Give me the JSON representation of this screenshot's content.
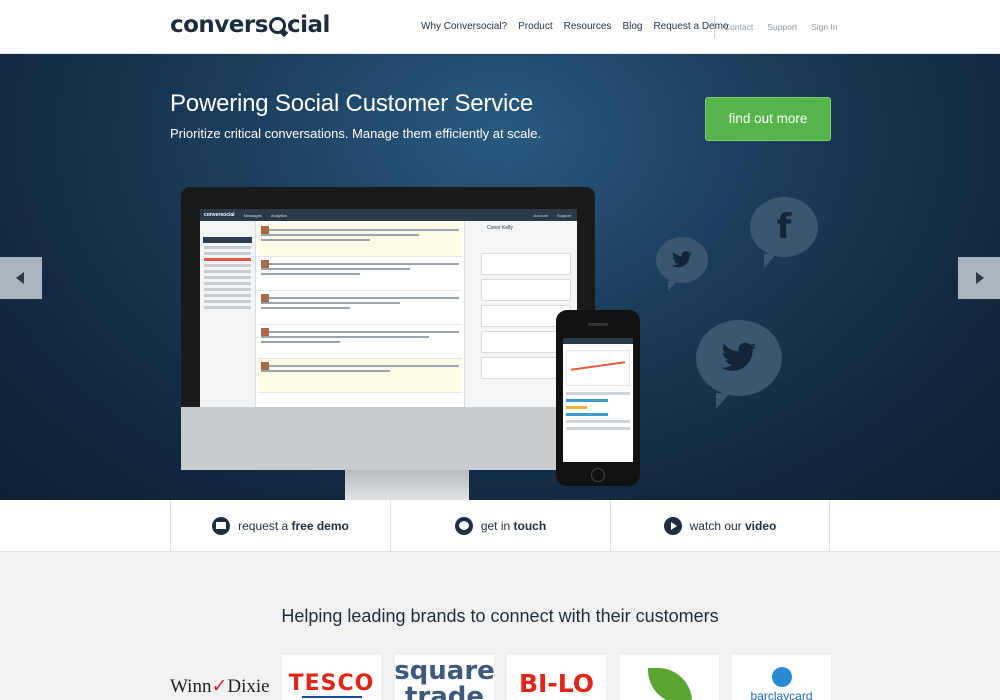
{
  "header": {
    "logo_text_pre": "convers",
    "logo_text_post": "cial",
    "nav_main": [
      "Why Conversocial?",
      "Product",
      "Resources",
      "Blog",
      "Request a Demo"
    ],
    "nav_secondary": [
      "Contact",
      "Support",
      "Sign In"
    ]
  },
  "hero": {
    "title": "Powering Social Customer Service",
    "subtitle": "Prioritize critical conversations. Manage them efficiently at scale.",
    "cta_label": "find out more",
    "social_icons": [
      "facebook-icon",
      "twitter-icon",
      "twitter-icon"
    ],
    "cta_color": "#55b54a",
    "background_color": "#1b3d5c"
  },
  "app_preview": {
    "brand": "conversocial",
    "tabs": [
      "Messages",
      "Analytics"
    ],
    "top_right": [
      "Account",
      "Support"
    ],
    "contact_name": "Conor Kelly"
  },
  "features": [
    {
      "icon": "monitor-icon",
      "prefix": "request a ",
      "bold": "free demo"
    },
    {
      "icon": "chat-icon",
      "prefix": "get in ",
      "bold": "touch"
    },
    {
      "icon": "play-icon",
      "prefix": "watch our ",
      "bold": "video"
    }
  ],
  "brands": {
    "title": "Helping leading brands to connect with their customers",
    "logos": {
      "winn": "Winn",
      "dixie": "Dixie",
      "tesco": "TESCO",
      "square": "square trade",
      "bilo": "BI-LO",
      "barclaycard": "barclaycard"
    }
  }
}
